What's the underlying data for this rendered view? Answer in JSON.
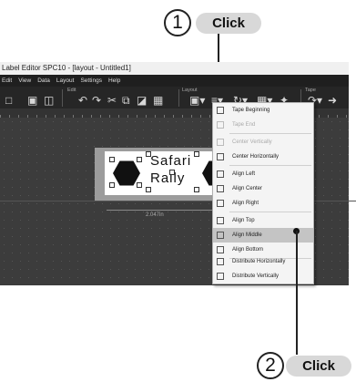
{
  "window_title": "Label Editor SPC10 - [layout - Untitled1]",
  "menu_bar": [
    "Edit",
    "View",
    "Data",
    "Layout",
    "Settings",
    "Help"
  ],
  "ribbon_groups": {
    "edit": "Edit",
    "layout": "Layout",
    "tape": "Tape"
  },
  "label_text": {
    "line1": "Safari",
    "line2": "Rally"
  },
  "dimension": "2.047in",
  "context_menu": [
    {
      "label": "Tape Beginning",
      "enabled": true
    },
    {
      "label": "Tape End",
      "enabled": false
    },
    {
      "label": "Center Vertically",
      "enabled": false
    },
    {
      "label": "Center Horizontally",
      "enabled": true
    },
    {
      "label": "Align Left",
      "enabled": true
    },
    {
      "label": "Align Center",
      "enabled": true
    },
    {
      "label": "Align Right",
      "enabled": true
    },
    {
      "label": "Align Top",
      "enabled": true
    },
    {
      "label": "Align Middle",
      "enabled": true,
      "highlighted": true
    },
    {
      "label": "Align Bottom",
      "enabled": true
    },
    {
      "label": "Distribute Horizontally",
      "enabled": true
    },
    {
      "label": "Distribute Vertically",
      "enabled": true
    }
  ],
  "callouts": {
    "step1_number": "1",
    "step1_action": "Click",
    "step2_number": "2",
    "step2_action": "Click"
  },
  "colors": {
    "app_background": "#2b2b2b",
    "menu_highlight": "#c4c4c4",
    "callout_pill": "#d8d8d8"
  }
}
